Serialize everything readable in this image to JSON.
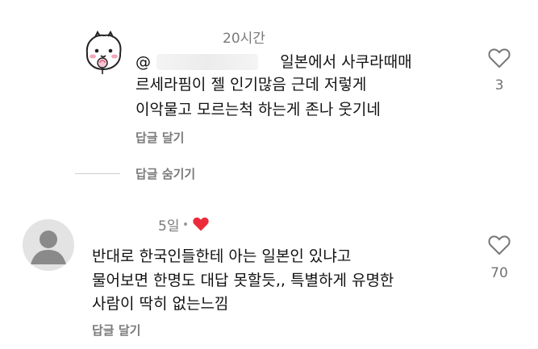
{
  "reply_comment": {
    "timestamp": "20시간",
    "mention_at": "@",
    "line1": "일본에서 사쿠라때매",
    "line2": "르세라핌이 젤 인기많음 근데 저렇게",
    "line3": "이악물고 모르는척 하는게 존나 웃기네",
    "reply_label": "답글 달기",
    "likes": "3"
  },
  "hide_replies_label": "답글 숨기기",
  "main_comment": {
    "timestamp": "5일",
    "line1": "반대로 한국인들한테 아는 일본인 있냐고",
    "line2": "물어보면 한명도 대답 못할듯,, 특별하게 유명한",
    "line3": "사람이 딱히 없는느낌",
    "reply_label": "답글 달기",
    "likes": "70"
  },
  "colors": {
    "heart_liked": "#ed2a3b",
    "meta_text": "#7a7a7a",
    "body_text": "#121212"
  },
  "icons": {
    "reply_avatar": "cartoon-face-avatar",
    "main_avatar": "default-user-avatar",
    "like": "heart-outline-icon",
    "author_liked": "heart-filled-icon"
  }
}
